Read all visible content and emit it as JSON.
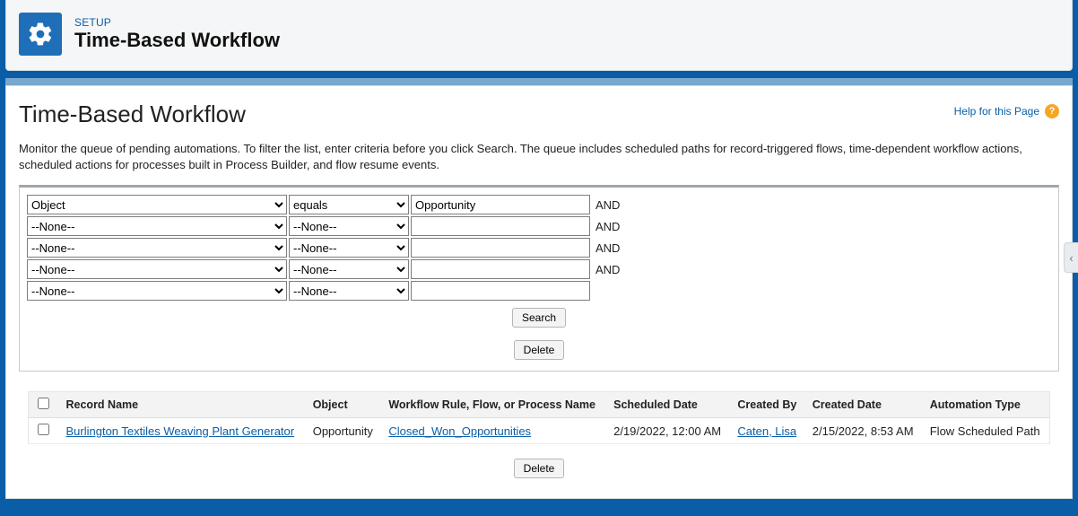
{
  "header": {
    "setup_label": "SETUP",
    "title": "Time-Based Workflow"
  },
  "page": {
    "title": "Time-Based Workflow",
    "help_text": "Help for this Page",
    "description": "Monitor the queue of pending automations. To filter the list, enter criteria before you click Search. The queue includes scheduled paths for record-triggered flows, time-dependent workflow actions, scheduled actions for processes built in Process Builder, and flow resume events."
  },
  "filter": {
    "rows": [
      {
        "field": "Object",
        "operator": "equals",
        "value": "Opportunity",
        "suffix": "AND"
      },
      {
        "field": "--None--",
        "operator": "--None--",
        "value": "",
        "suffix": "AND"
      },
      {
        "field": "--None--",
        "operator": "--None--",
        "value": "",
        "suffix": "AND"
      },
      {
        "field": "--None--",
        "operator": "--None--",
        "value": "",
        "suffix": "AND"
      },
      {
        "field": "--None--",
        "operator": "--None--",
        "value": "",
        "suffix": ""
      }
    ],
    "search_label": "Search",
    "delete_label": "Delete"
  },
  "table": {
    "headers": {
      "record_name": "Record Name",
      "object": "Object",
      "workflow": "Workflow Rule, Flow, or Process Name",
      "scheduled_date": "Scheduled Date",
      "created_by": "Created By",
      "created_date": "Created Date",
      "automation_type": "Automation Type"
    },
    "rows": [
      {
        "record_name": "Burlington Textiles Weaving Plant Generator",
        "object": "Opportunity",
        "workflow": "Closed_Won_Opportunities",
        "scheduled_date": "2/19/2022, 12:00 AM",
        "created_by": "Caten, Lisa",
        "created_date": "2/15/2022, 8:53 AM",
        "automation_type": "Flow Scheduled Path"
      }
    ],
    "delete_label": "Delete"
  }
}
